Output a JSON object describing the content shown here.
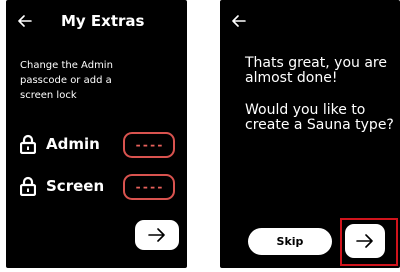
{
  "left_screen": {
    "title": "My Extras",
    "description": "Change the Admin passcode or add a screen lock",
    "rows": [
      {
        "label": "Admin",
        "value": "----"
      },
      {
        "label": "Screen",
        "value": "----"
      }
    ],
    "icons": {
      "back": "arrow-left-icon",
      "lock": "lock-icon",
      "next": "arrow-right-icon"
    }
  },
  "right_screen": {
    "message": "Thats great, you are almost done!",
    "question": "Would you like to create a Sauna type?",
    "skip_label": "Skip",
    "icons": {
      "back": "arrow-left-icon",
      "next": "arrow-right-icon"
    }
  },
  "colors": {
    "screen_bg": "#000000",
    "text": "#ffffff",
    "field_border": "#d9534f",
    "highlight": "#d0141c"
  }
}
